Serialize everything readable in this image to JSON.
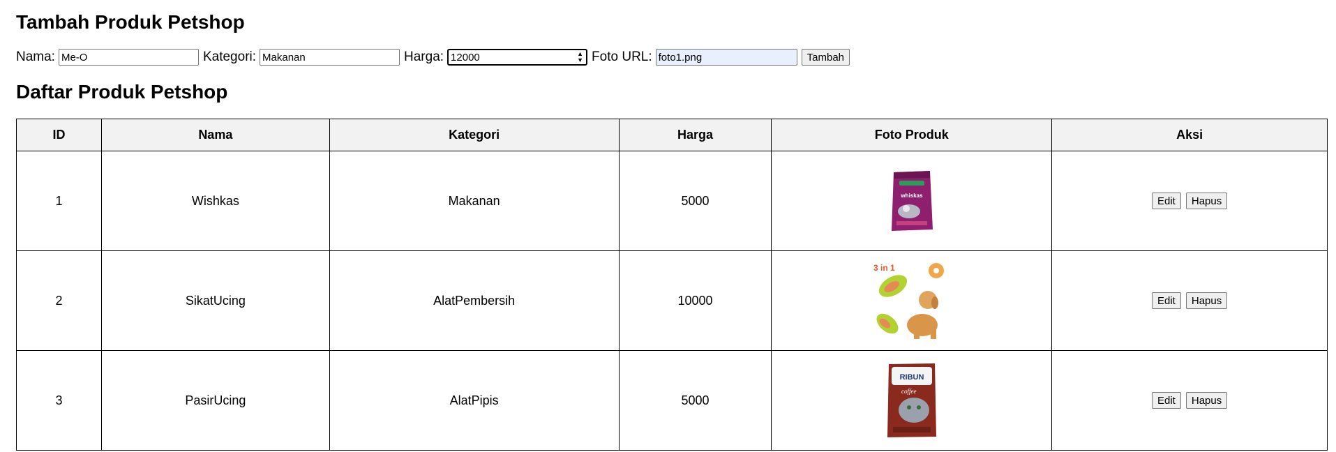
{
  "add_section": {
    "title": "Tambah Produk Petshop",
    "nama_label": "Nama:",
    "nama_value": "Me-O",
    "kategori_label": "Kategori:",
    "kategori_value": "Makanan",
    "harga_label": "Harga:",
    "harga_value": "12000",
    "foto_label": "Foto URL:",
    "foto_value": "foto1.png",
    "submit_label": "Tambah"
  },
  "list_section": {
    "title": "Daftar Produk Petshop",
    "columns": [
      "ID",
      "Nama",
      "Kategori",
      "Harga",
      "Foto Produk",
      "Aksi"
    ],
    "rows": [
      {
        "id": "1",
        "nama": "Wishkas",
        "kategori": "Makanan",
        "harga": "5000",
        "photo": "whiskas-cat-food-bag"
      },
      {
        "id": "2",
        "nama": "SikatUcing",
        "kategori": "AlatPembersih",
        "harga": "10000",
        "photo": "pet-brush-with-dog"
      },
      {
        "id": "3",
        "nama": "PasirUcing",
        "kategori": "AlatPipis",
        "harga": "5000",
        "photo": "cat-litter-bag"
      }
    ],
    "edit_label": "Edit",
    "delete_label": "Hapus"
  },
  "photo_text": {
    "brand_logo_text": "whiskas",
    "promo_badge": "3 in 1",
    "litter_brand": "RIBUN",
    "litter_variant": "coffee"
  }
}
